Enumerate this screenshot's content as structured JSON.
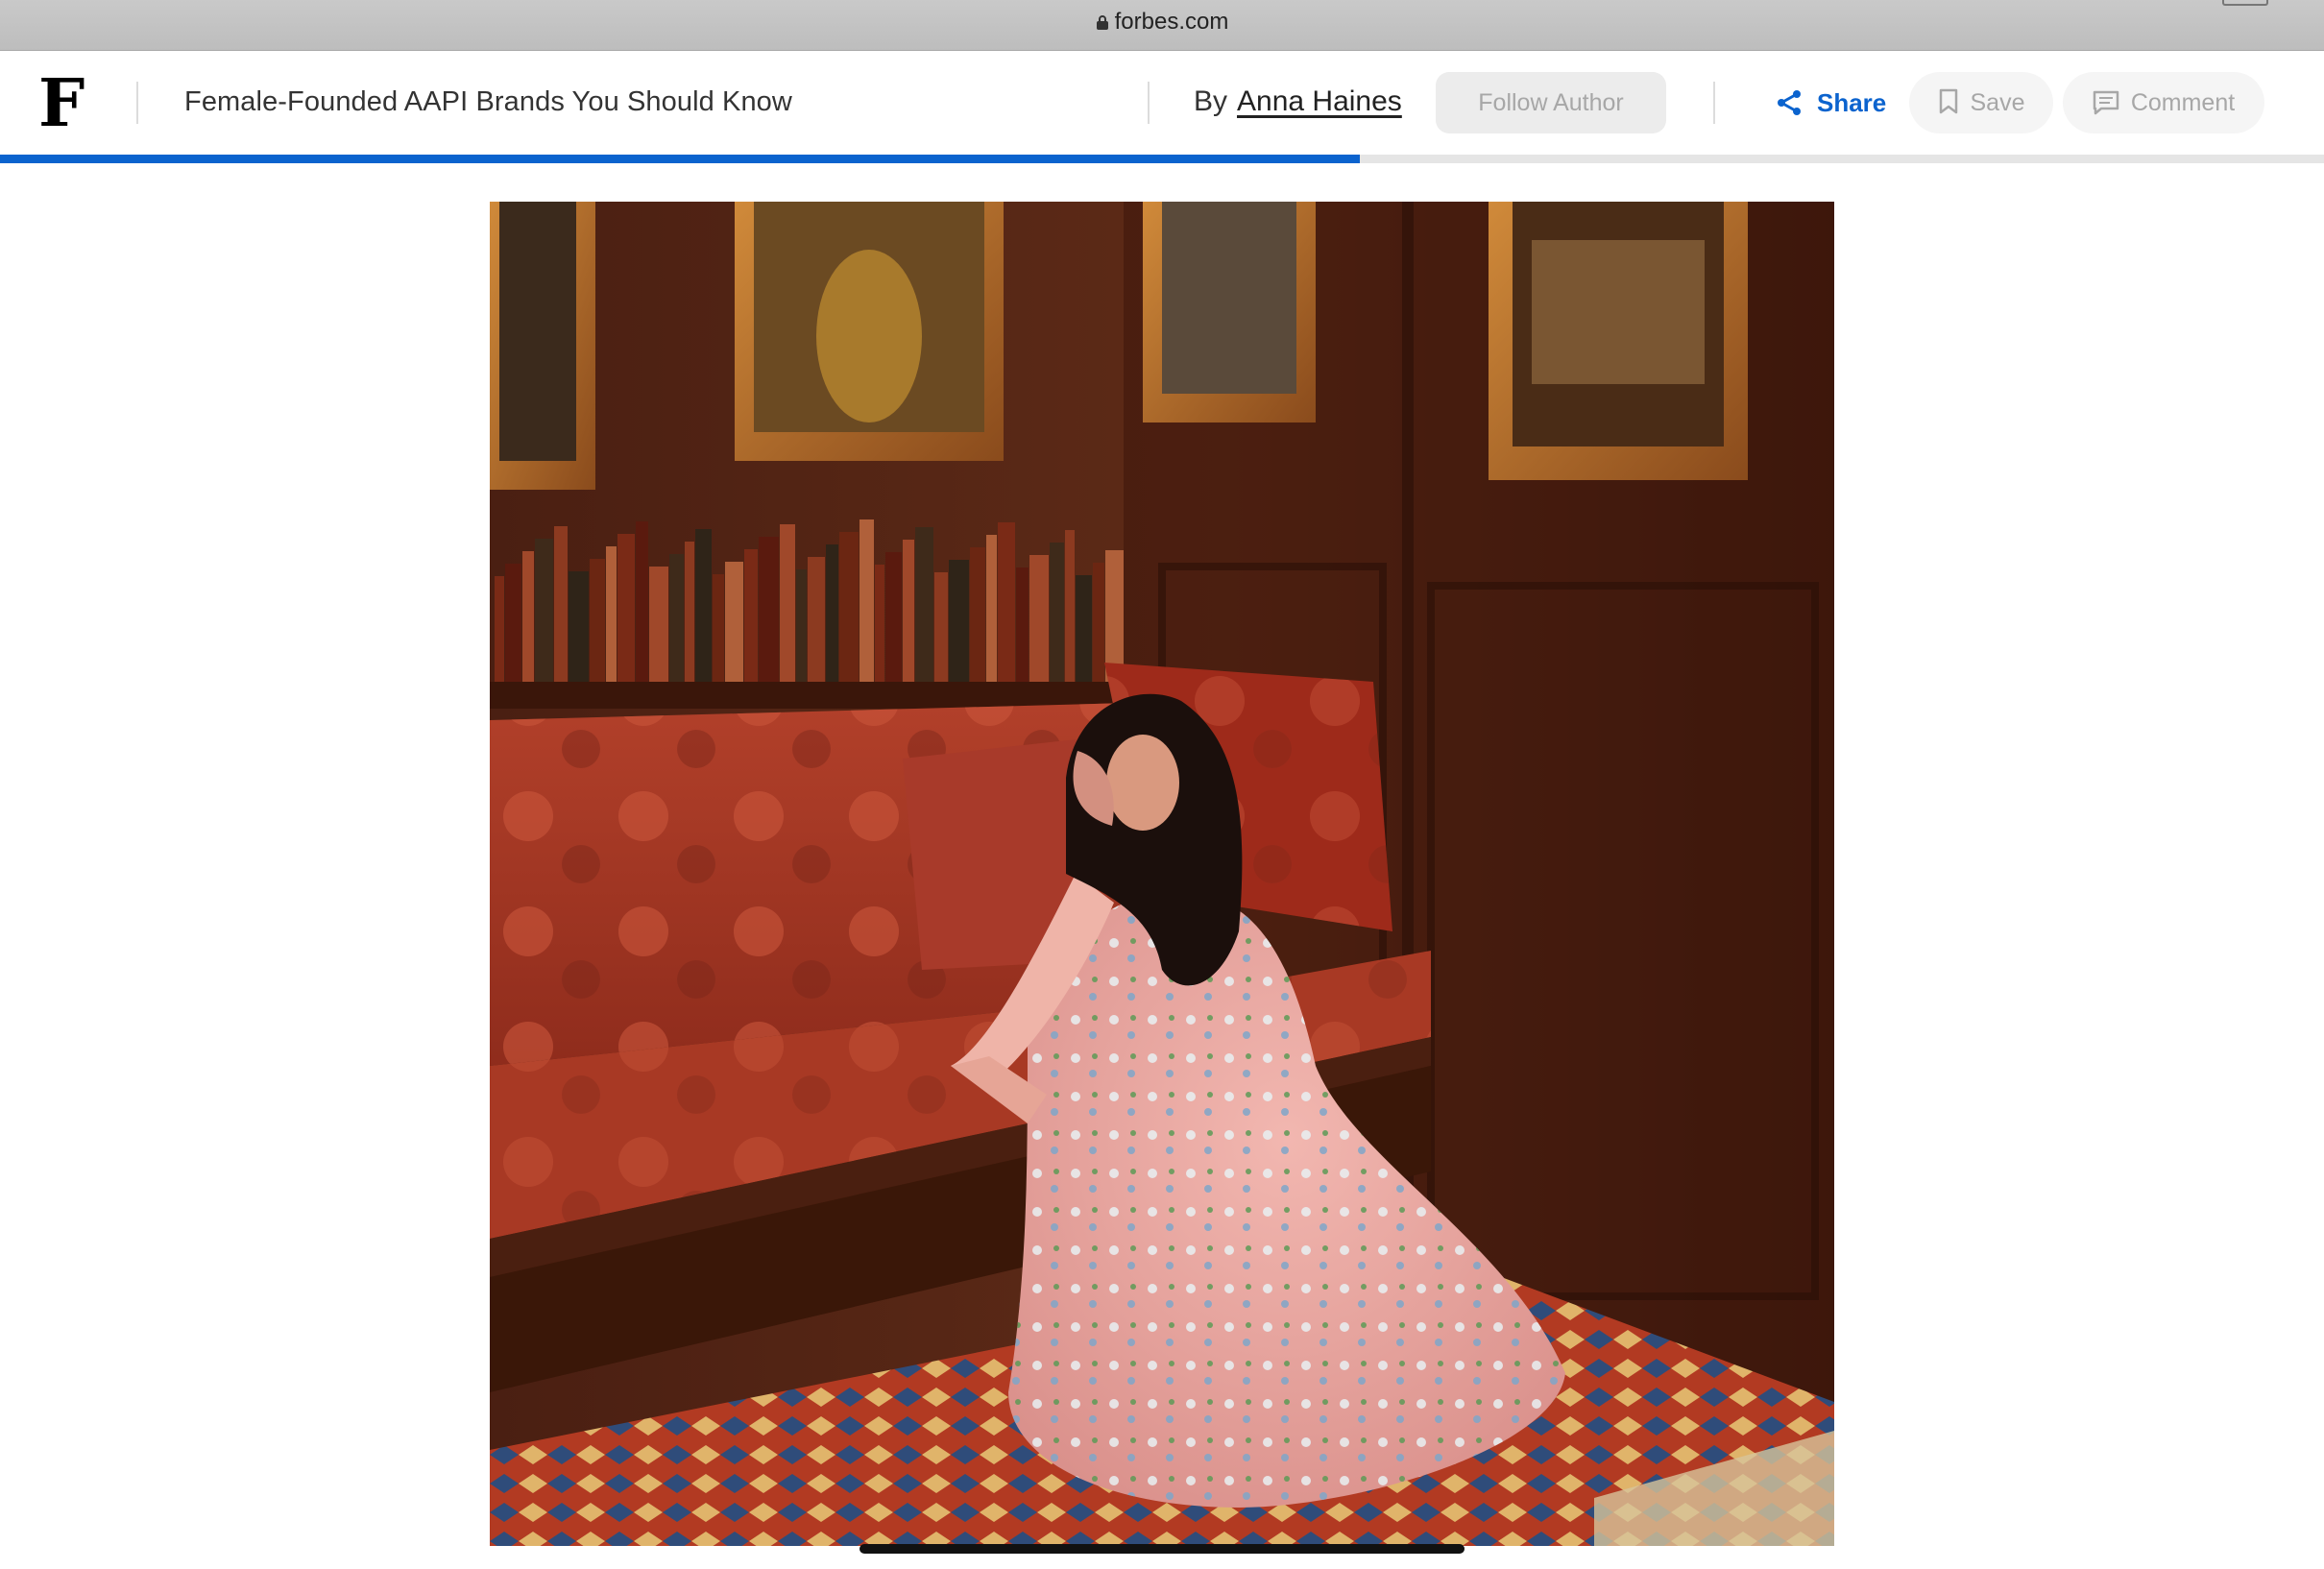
{
  "browser": {
    "url": "forbes.com"
  },
  "header": {
    "logo": "F",
    "article_title": "Female-Founded AAPI Brands You Should Know",
    "by_label": "By",
    "author_name": "Anna Haines",
    "follow_label": "Follow Author",
    "share_label": "Share",
    "save_label": "Save",
    "comment_label": "Comment",
    "reading_progress_percent": 58.5,
    "accent_color": "#0b63ce"
  },
  "article": {
    "hero_image_icon": "photo-woman-seated-floral-dress",
    "caption_partial": ""
  }
}
